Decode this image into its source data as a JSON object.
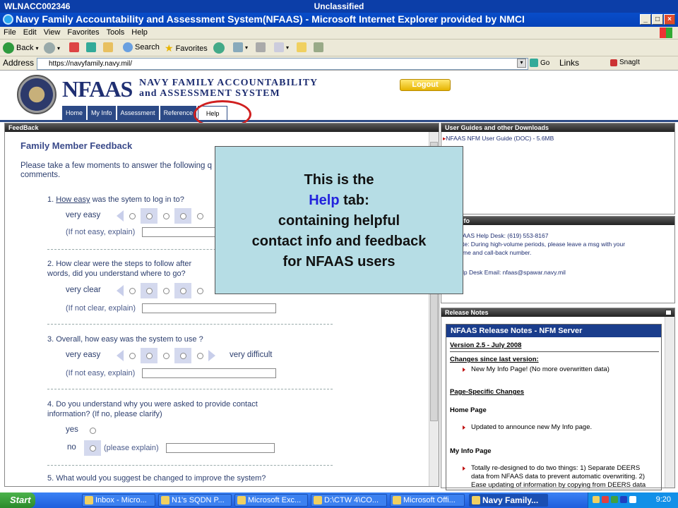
{
  "classification_bar": {
    "left": "WLNACC002346",
    "center": "Unclassified"
  },
  "window": {
    "title": "Navy Family Accountability and Assessment System(NFAAS) - Microsoft Internet Explorer provided by NMCI"
  },
  "menu": [
    "File",
    "Edit",
    "View",
    "Favorites",
    "Tools",
    "Help"
  ],
  "toolbar": {
    "back": "Back",
    "search": "Search",
    "favorites": "Favorites"
  },
  "address": {
    "label": "Address",
    "url": "https://navyfamily.navy.mil/",
    "go": "Go",
    "links": "Links",
    "snagit": "SnagIt"
  },
  "header": {
    "logo_main": "NFAAS",
    "logo_line1": "NAVY FAMILY ACCOUNTABILITY",
    "logo_line2": "and ASSESSMENT SYSTEM",
    "logout": "Logout",
    "tabs": [
      "Home",
      "My Info",
      "Assessment",
      "Reference",
      "Help"
    ],
    "active_tab": "Help"
  },
  "feedback": {
    "panel_title": "FeedBack",
    "heading": "Family Member Feedback",
    "intro_line1": "Please take a few moments to answer the following q",
    "intro_line2": "comments.",
    "q1": {
      "num": "1.",
      "link": "How easy",
      "rest": "was the sytem to log in to?",
      "left": "very easy",
      "hint": "(If not easy, explain)"
    },
    "q2": {
      "line1": "2. How clear were the steps to follow after",
      "line2": "words, did you understand where to go?",
      "left": "very clear",
      "hint": "(If not clear, explain)"
    },
    "q3": {
      "text": "3. Overall, how easy was the system to use ?",
      "left": "very easy",
      "right": "very difficult",
      "hint": "(If not easy, explain)"
    },
    "q4": {
      "line1": "4. Do you understand why you were asked to provide contact",
      "line2": "information? (If no, please clarify)",
      "yes": "yes",
      "no": "no",
      "hint": "(please explain)"
    },
    "q5": {
      "text": "5. What would you suggest be changed to improve the system?"
    }
  },
  "guides": {
    "panel_title": "User Guides and other Downloads",
    "item": "NFAAS NFM User Guide (DOC) - 5.6MB"
  },
  "contact": {
    "panel_title": "tact Info",
    "line1": "AAS Help Desk: (619) 553-8167",
    "line2": "te: During high-volume periods, please leave a msg with your",
    "line3": "me and call-back number.",
    "line4": "lp Desk Email: nfaas@spawar.navy.mil"
  },
  "release": {
    "panel_title": "Release Notes",
    "box_title": "NFAAS Release Notes - NFM Server",
    "version": "Version 2.5 - July 2008",
    "changes_heading": "Changes since last version:",
    "change1": "New My Info Page! (No more overwritten data)",
    "page_specific": "Page-Specific Changes",
    "home_page": "Home Page",
    "home_note": "Updated to announce new My Info page.",
    "myinfo_page": "My Info Page",
    "myinfo_note1": "Totally re-designed to do two things: 1) Separate DEERS",
    "myinfo_note2": "data from NFAAS data to prevent automatic overwriting. 2)",
    "myinfo_note3": "Ease updating of information by copying from DEERS data"
  },
  "callout": {
    "line1": "This is the",
    "help_word": "Help",
    "line2_rest": " tab:",
    "line3": "containing helpful",
    "line4": "contact info and feedback",
    "line5": "for NFAAS users"
  },
  "taskbar": {
    "start": "Start",
    "tasks": [
      "Inbox - Micro...",
      "N1's SQDN P...",
      "Microsoft Exc...",
      "D:\\CTW 4\\CO...",
      "Microsoft Offi...",
      "Navy Family..."
    ],
    "clock": "9:20"
  }
}
